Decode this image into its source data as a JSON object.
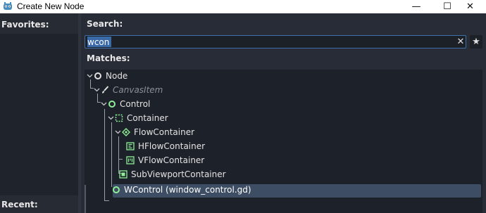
{
  "window": {
    "title": "Create New Node",
    "minimize_glyph": "—",
    "maximize_glyph": "☐",
    "close_glyph": "✕"
  },
  "favorites": {
    "label": "Favorites:"
  },
  "recent": {
    "label": "Recent:"
  },
  "search": {
    "label": "Search:",
    "value": "wcon",
    "clear_glyph": "✕",
    "favorite_glyph": "★"
  },
  "matches": {
    "label": "Matches:",
    "tree": [
      {
        "label": "Node",
        "icon": "node-circle-icon",
        "expanded": true,
        "dim": false
      },
      {
        "label": "CanvasItem",
        "icon": "canvasitem-brush-icon",
        "expanded": true,
        "dim": true
      },
      {
        "label": "Control",
        "icon": "control-circle-icon",
        "expanded": true,
        "dim": false
      },
      {
        "label": "Container",
        "icon": "container-dashed-icon",
        "expanded": true,
        "dim": false
      },
      {
        "label": "FlowContainer",
        "icon": "flowcontainer-icon",
        "expanded": true,
        "dim": false
      },
      {
        "label": "HFlowContainer",
        "icon": "hflowcontainer-icon",
        "expanded": false,
        "dim": false
      },
      {
        "label": "VFlowContainer",
        "icon": "vflowcontainer-icon",
        "expanded": false,
        "dim": false
      },
      {
        "label": "SubViewportContainer",
        "icon": "subviewportcontainer-icon",
        "expanded": false,
        "dim": false
      },
      {
        "label": "WControl (window_control.gd)",
        "icon": "wcontrol-circle-icon",
        "expanded": false,
        "dim": false,
        "selected": true
      }
    ]
  },
  "colors": {
    "accent_green": "#8eef97",
    "selection": "#3d4d63",
    "input_border": "#3f6fa8"
  }
}
